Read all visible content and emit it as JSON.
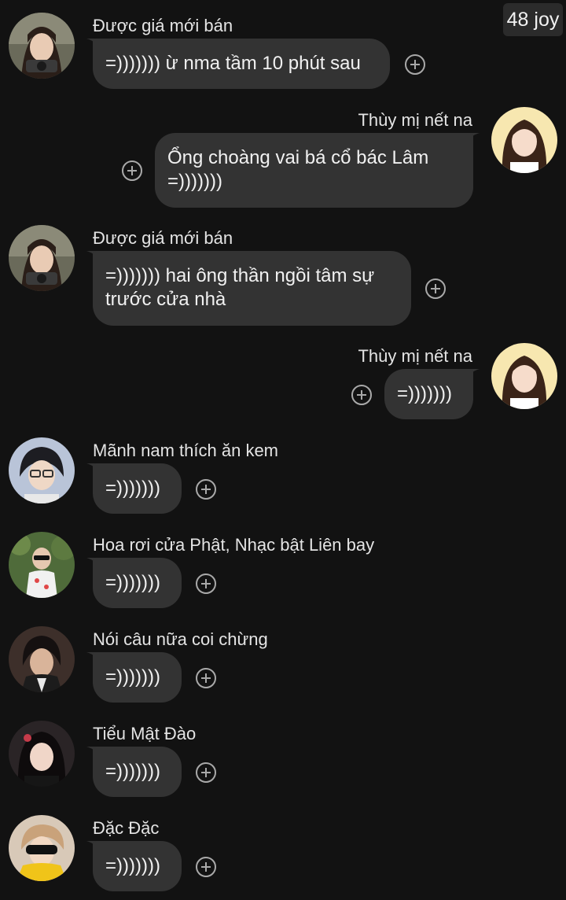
{
  "header": {
    "joy_badge": "48 joy"
  },
  "messages": [
    {
      "sender": "Được giá mới bán",
      "text": "=))))))) ừ nma tầm 10 phút sau",
      "avatar": "avatar-girl-camera"
    },
    {
      "sender": "Thùy mị nết na",
      "text": "Ổng choàng vai bá cổ bác Lâm =)))))))",
      "avatar": "avatar-anime-girl"
    },
    {
      "sender": "Được giá mới bán",
      "text": "=))))))) hai ông thần ngồi tâm sự trước cửa nhà",
      "avatar": "avatar-girl-camera"
    },
    {
      "sender": "Thùy mị nết na",
      "text": "=)))))))",
      "avatar": "avatar-anime-girl"
    },
    {
      "sender": "Mãnh nam thích ăn kem",
      "text": "=)))))))",
      "avatar": "avatar-boy-glasses"
    },
    {
      "sender": "Hoa rơi cửa Phật, Nhạc bật Liên bay",
      "text": "=)))))))",
      "avatar": "avatar-boy-sunglasses"
    },
    {
      "sender": "Nói câu nữa coi chừng",
      "text": "=)))))))",
      "avatar": "avatar-boy-dark"
    },
    {
      "sender": "Tiểu Mật Đào",
      "text": "=)))))))",
      "avatar": "avatar-girl-dark-hair"
    },
    {
      "sender": "Đặc Đặc",
      "text": "=)))))))",
      "avatar": "avatar-boy-shades"
    }
  ]
}
